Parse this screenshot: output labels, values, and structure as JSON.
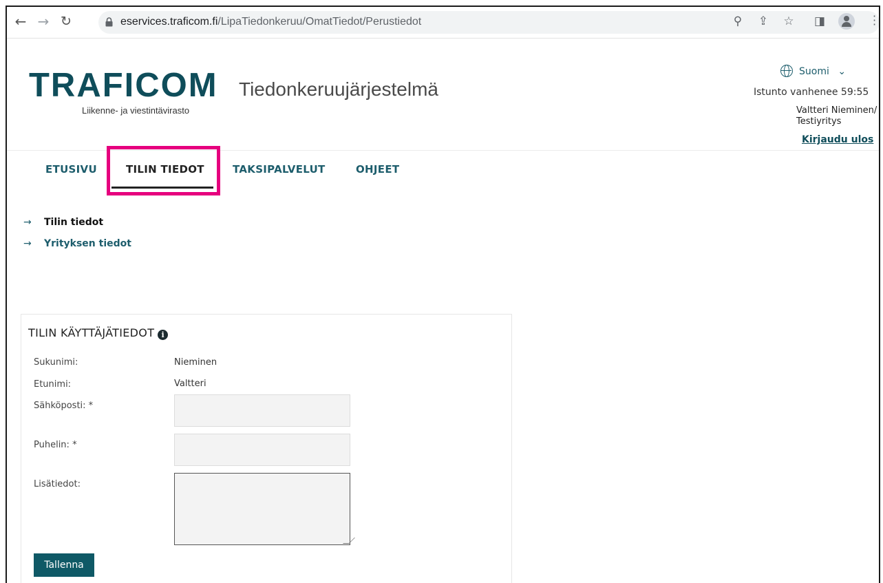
{
  "browser": {
    "url_host": "eservices.traficom.fi",
    "url_path": "/LipaTiedonkeruu/OmatTiedot/Perustiedot"
  },
  "header": {
    "logo_word": "TRAFICOM",
    "logo_subtitle": "Liikenne- ja viestintävirasto",
    "app_title": "Tiedonkeruujärjestelmä",
    "language": "Suomi",
    "session_text": "Istunto vanhenee 59:55",
    "user_line1": "Valtteri Nieminen/",
    "user_line2": "Testiyritys",
    "logout": "Kirjaudu ulos"
  },
  "nav": {
    "tabs": [
      {
        "label": "ETUSIVU"
      },
      {
        "label": "TILIN TIEDOT"
      },
      {
        "label": "TAKSIPALVELUT"
      },
      {
        "label": "OHJEET"
      }
    ],
    "active_tab": "TILIN TIEDOT"
  },
  "subnav": {
    "items": [
      {
        "label": "Tilin tiedot"
      },
      {
        "label": "Yrityksen tiedot"
      }
    ]
  },
  "form": {
    "title": "TILIN KÄYTTÄJÄTIEDOT",
    "info_icon_glyph": "i",
    "fields": {
      "surname_label": "Sukunimi:",
      "surname_value": "Nieminen",
      "firstname_label": "Etunimi:",
      "firstname_value": "Valtteri",
      "email_label": "Sähköposti: *",
      "email_value": "",
      "phone_label": "Puhelin: *",
      "phone_value": "",
      "extra_label": "Lisätiedot:",
      "extra_value": ""
    },
    "save_label": "Tallenna"
  },
  "colors": {
    "brand": "#0f4d5a",
    "link": "#1d5d6c",
    "highlight": "#e6007e",
    "button": "#0f5966"
  },
  "icons": [
    "back-arrow-icon",
    "forward-arrow-icon",
    "reload-icon",
    "lock-icon",
    "zoom-icon",
    "share-icon",
    "star-icon",
    "sidepanel-icon",
    "profile-icon",
    "menu-icon",
    "globe-icon",
    "chevron-down-icon",
    "arrow-right-icon",
    "info-icon"
  ]
}
